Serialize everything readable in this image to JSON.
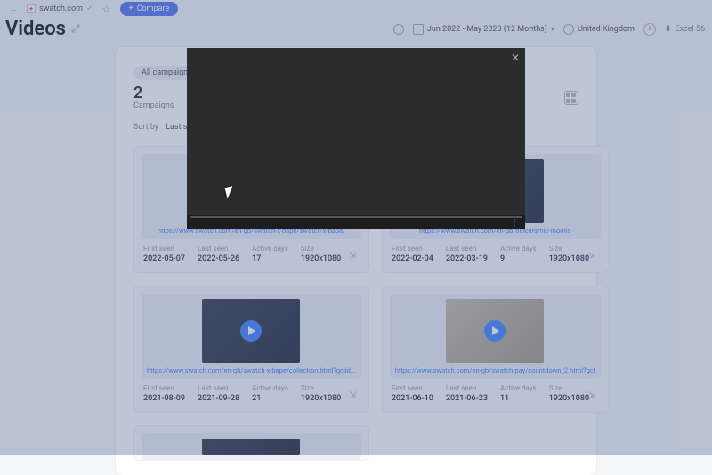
{
  "topbar": {
    "domain": "swatch.com",
    "compare_label": "Compare"
  },
  "header": {
    "title": "Videos",
    "date_range": "Jun 2022 - May 2023 (12 Months)",
    "country": "United Kingdom",
    "export": "Excel 56"
  },
  "panel": {
    "filter_chip": "All campaigns",
    "count": "2",
    "count_label": "Campaigns",
    "sort_by": "Sort by",
    "sort_value": "Last seen"
  },
  "cards": [
    {
      "url": "https://www.swatch.com/en-gb/swatch-x-bape/swatch-x-bape/",
      "first_seen_lbl": "First seen",
      "first_seen": "2022-05-07",
      "last_seen_lbl": "Last seen",
      "last_seen": "2022-05-26",
      "active_lbl": "Active days",
      "active": "17",
      "size_lbl": "Size",
      "size": "1920x1080"
    },
    {
      "url": "https://www.swatch.com/en-gb/bioceramic-moons",
      "first_seen_lbl": "First seen",
      "first_seen": "2022-02-04",
      "last_seen_lbl": "Last seen",
      "last_seen": "2022-03-19",
      "active_lbl": "Active days",
      "active": "9",
      "size_lbl": "Size",
      "size": "1920x1080"
    },
    {
      "url": "https://www.swatch.com/en-gb/swatch-x-bape/collection.html?gclid...",
      "first_seen_lbl": "First seen",
      "first_seen": "2021-08-09",
      "last_seen_lbl": "Last seen",
      "last_seen": "2021-09-28",
      "active_lbl": "Active days",
      "active": "21",
      "size_lbl": "Size",
      "size": "1920x1080"
    },
    {
      "url": "https://www.swatch.com/en-gb/swatch-pay/countdown_2.html?gcl",
      "first_seen_lbl": "First seen",
      "first_seen": "2021-06-10",
      "last_seen_lbl": "Last seen",
      "last_seen": "2021-06-23",
      "active_lbl": "Active days",
      "active": "11",
      "size_lbl": "Size",
      "size": "1920x1080"
    }
  ]
}
